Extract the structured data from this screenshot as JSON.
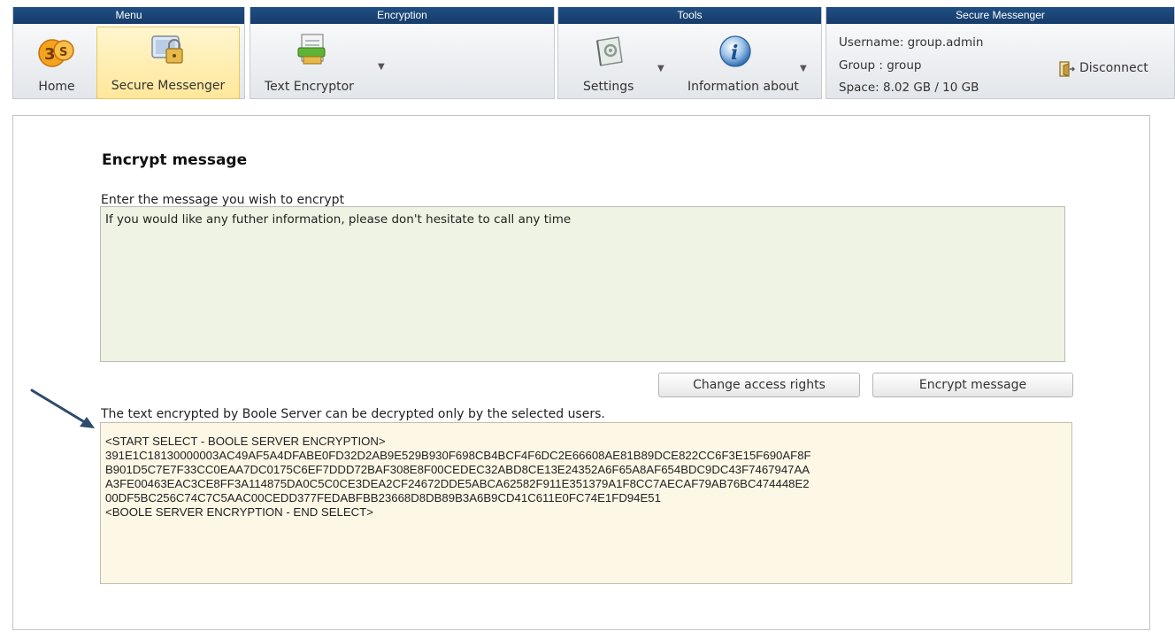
{
  "ribbon": {
    "menu": {
      "header": "Menu",
      "home_label": "Home",
      "secure_messenger_label": "Secure Messenger"
    },
    "encryption": {
      "header": "Encryption",
      "text_encryptor_label": "Text Encryptor"
    },
    "tools": {
      "header": "Tools",
      "settings_label": "Settings",
      "information_label": "Information about"
    },
    "secure_messenger": {
      "header": "Secure Messenger",
      "username": "Username: group.admin",
      "group": "Group : group",
      "space": "Space: 8.02 GB / 10 GB",
      "disconnect_label": "Disconnect"
    }
  },
  "main": {
    "title": "Encrypt message",
    "message_prompt": "Enter the message you wish to encrypt",
    "message_text": "If you would like any futher information, please don't hesitate to call any time",
    "change_access_button": "Change access rights",
    "encrypt_button": "Encrypt message",
    "note": "The text encrypted by Boole Server can be decrypted only by the selected users.",
    "encrypted_lines": [
      "<START SELECT - BOOLE SERVER ENCRYPTION>",
      "391E1C18130000003AC49AF5A4DFABE0FD32D2AB9E529B930F698CB4BCF4F6DC2E66608AE81B89DCE822CC6F3E15F690AF8F",
      "B901D5C7E7F33CC0EAA7DC0175C6EF7DDD72BAF308E8F00CEDEC32ABD8CE13E24352A6F65A8AF654BDC9DC43F7467947AA",
      "A3FE00463EAC3CE8FF3A114875DA0C5C0CE3DEA2CF24672DDE5ABCA62582F911E351379A1F8CC7AECAF79AB76BC474448E2",
      "00DF5BC256C74C7C5AAC00CEDD377FEDABFBB23668D8DB89B3A6B9CD41C611E0FC74E1FD94E51",
      "<BOOLE SERVER ENCRYPTION - END SELECT>"
    ]
  },
  "colors": {
    "ribbon_header": "#1f4f85",
    "active_button": "#ffe79a",
    "message_box": "#eef3e3",
    "encrypted_box": "#fdf7e6",
    "arrow": "#2d4a6b"
  }
}
